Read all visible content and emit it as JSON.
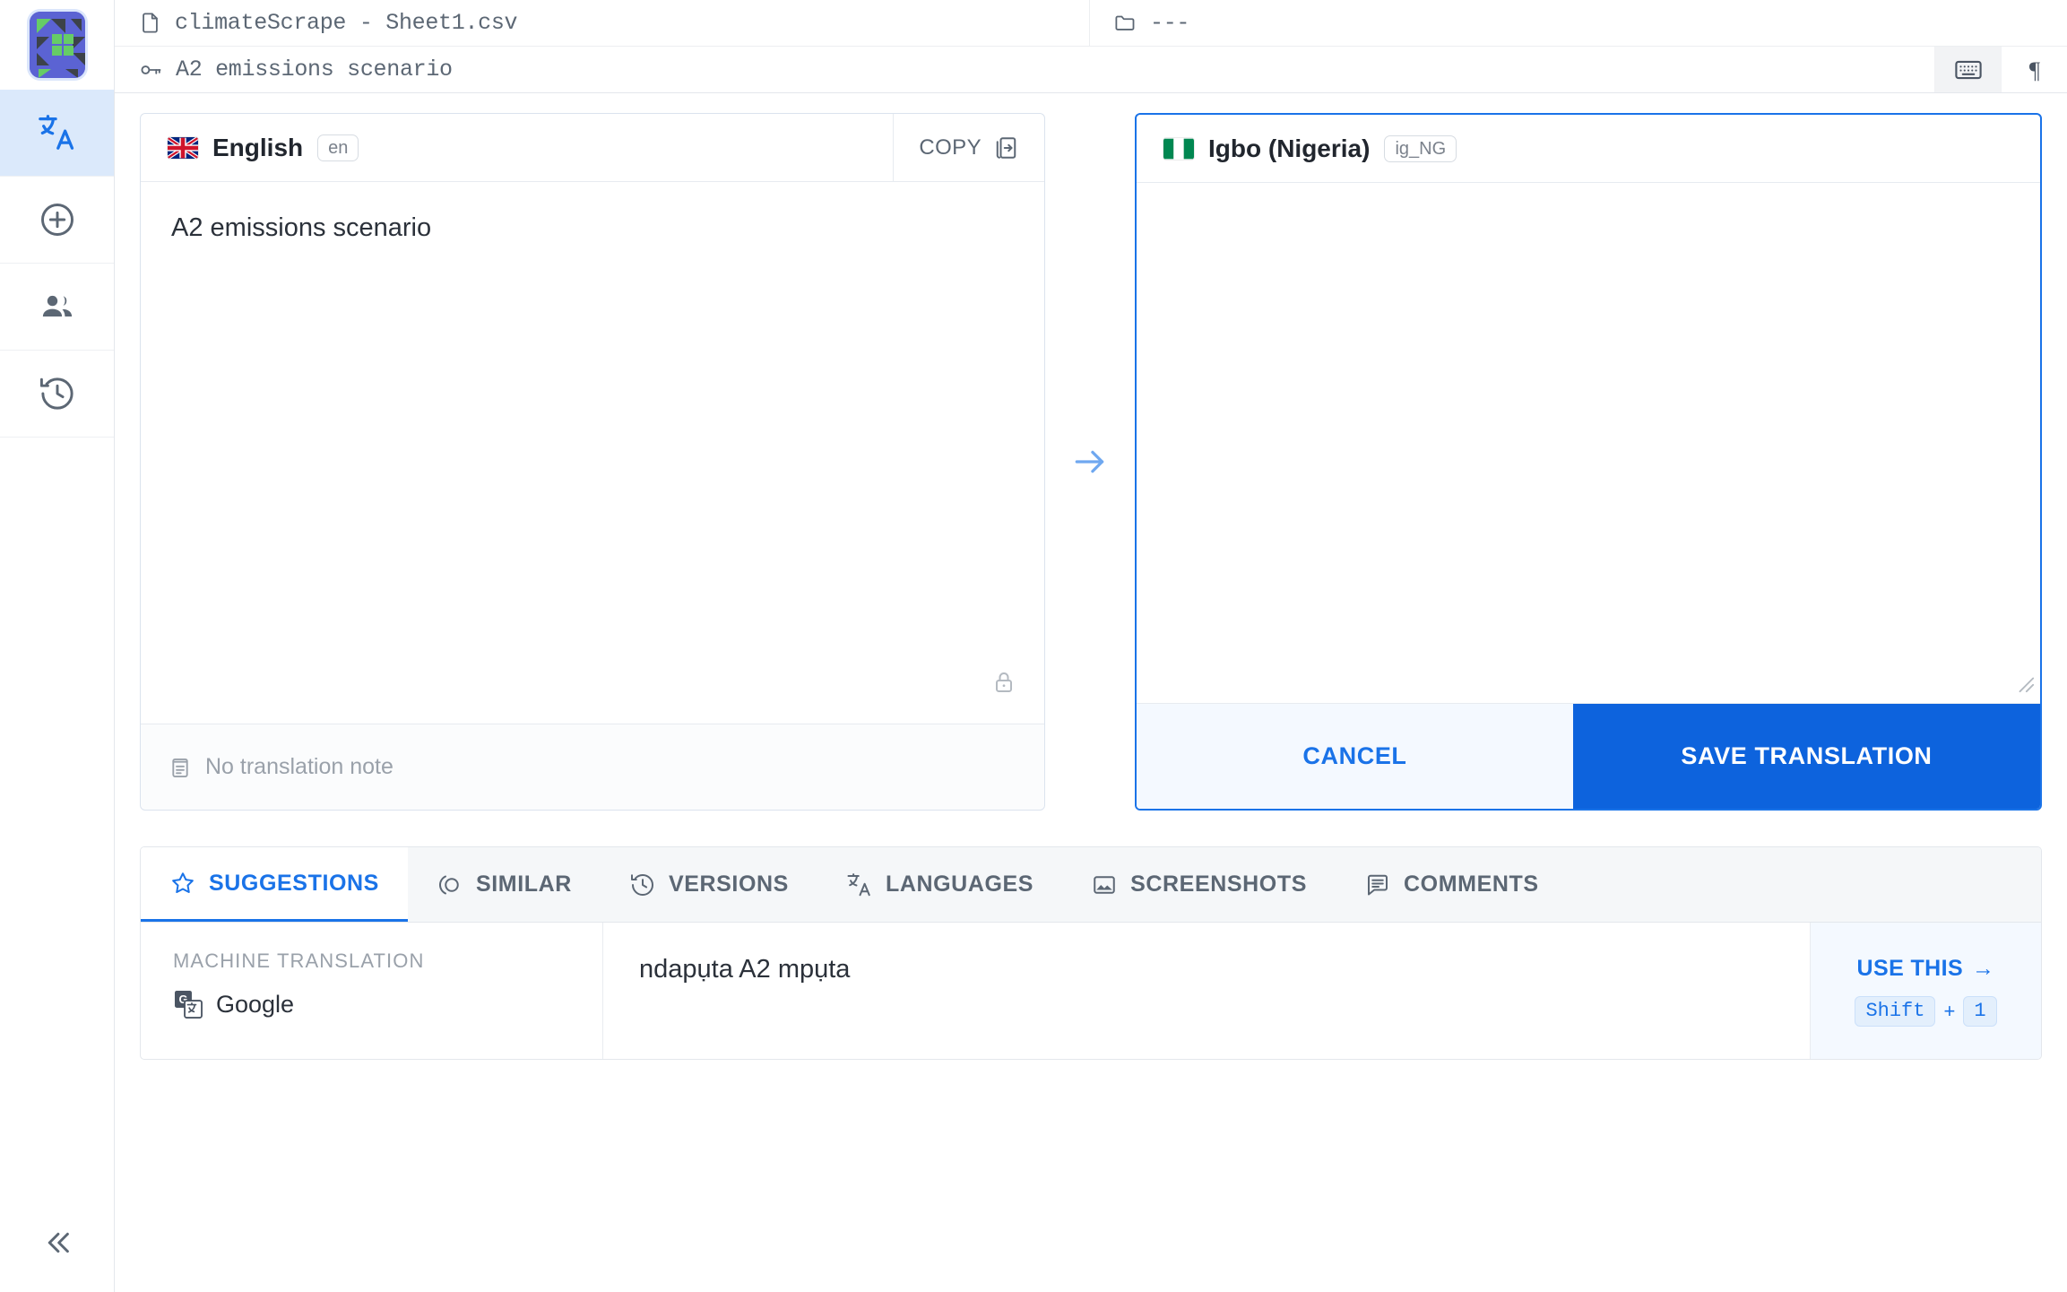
{
  "rail": {
    "logo_name": "app-logo",
    "items": [
      {
        "name": "translate",
        "icon": "translate-icon",
        "active": true
      },
      {
        "name": "add",
        "icon": "plus-circle-icon",
        "active": false
      },
      {
        "name": "team",
        "icon": "people-icon",
        "active": false
      },
      {
        "name": "history",
        "icon": "history-icon",
        "active": false
      }
    ],
    "collapse_icon": "chevron-double-left-icon"
  },
  "topbar": {
    "file_icon": "file-icon",
    "file_name": "climateScrape - Sheet1.csv",
    "folder_icon": "folder-icon",
    "folder_name": "---"
  },
  "keyrow": {
    "key_icon": "key-icon",
    "key_name": "A2 emissions scenario",
    "keyboard_icon": "keyboard-icon",
    "paragraph_icon": "pilcrow-icon"
  },
  "source": {
    "flag_icon": "flag-uk-icon",
    "language": "English",
    "code": "en",
    "copy_label": "COPY",
    "copy_icon": "copy-icon",
    "text": "A2 emissions scenario",
    "lock_icon": "lock-icon",
    "note_icon": "note-icon",
    "note_text": "No translation note"
  },
  "arrow_icon": "arrow-right-icon",
  "target": {
    "flag_icon": "flag-nigeria-icon",
    "language": "Igbo (Nigeria)",
    "code": "ig_NG",
    "value": "",
    "placeholder": "",
    "cancel_label": "CANCEL",
    "save_label": "SAVE TRANSLATION"
  },
  "tabs": [
    {
      "label": "SUGGESTIONS",
      "icon": "star-icon",
      "active": true
    },
    {
      "label": "SIMILAR",
      "icon": "similar-icon",
      "active": false
    },
    {
      "label": "VERSIONS",
      "icon": "history-icon",
      "active": false
    },
    {
      "label": "LANGUAGES",
      "icon": "translate-icon",
      "active": false
    },
    {
      "label": "SCREENSHOTS",
      "icon": "image-icon",
      "active": false
    },
    {
      "label": "COMMENTS",
      "icon": "comment-icon",
      "active": false
    }
  ],
  "suggestion": {
    "kind": "MACHINE TRANSLATION",
    "engine_icon": "google-translate-icon",
    "engine": "Google",
    "text": "ndapụta A2 mpụta",
    "use_label": "USE THIS",
    "use_arrow": "→",
    "shortcut_key": "Shift",
    "shortcut_plus": "+",
    "shortcut_num": "1"
  },
  "colors": {
    "accent": "#1a73e8",
    "save_button": "#0d63dd",
    "rail_active": "#dbe9fb",
    "muted_text": "#9aa1aa"
  }
}
